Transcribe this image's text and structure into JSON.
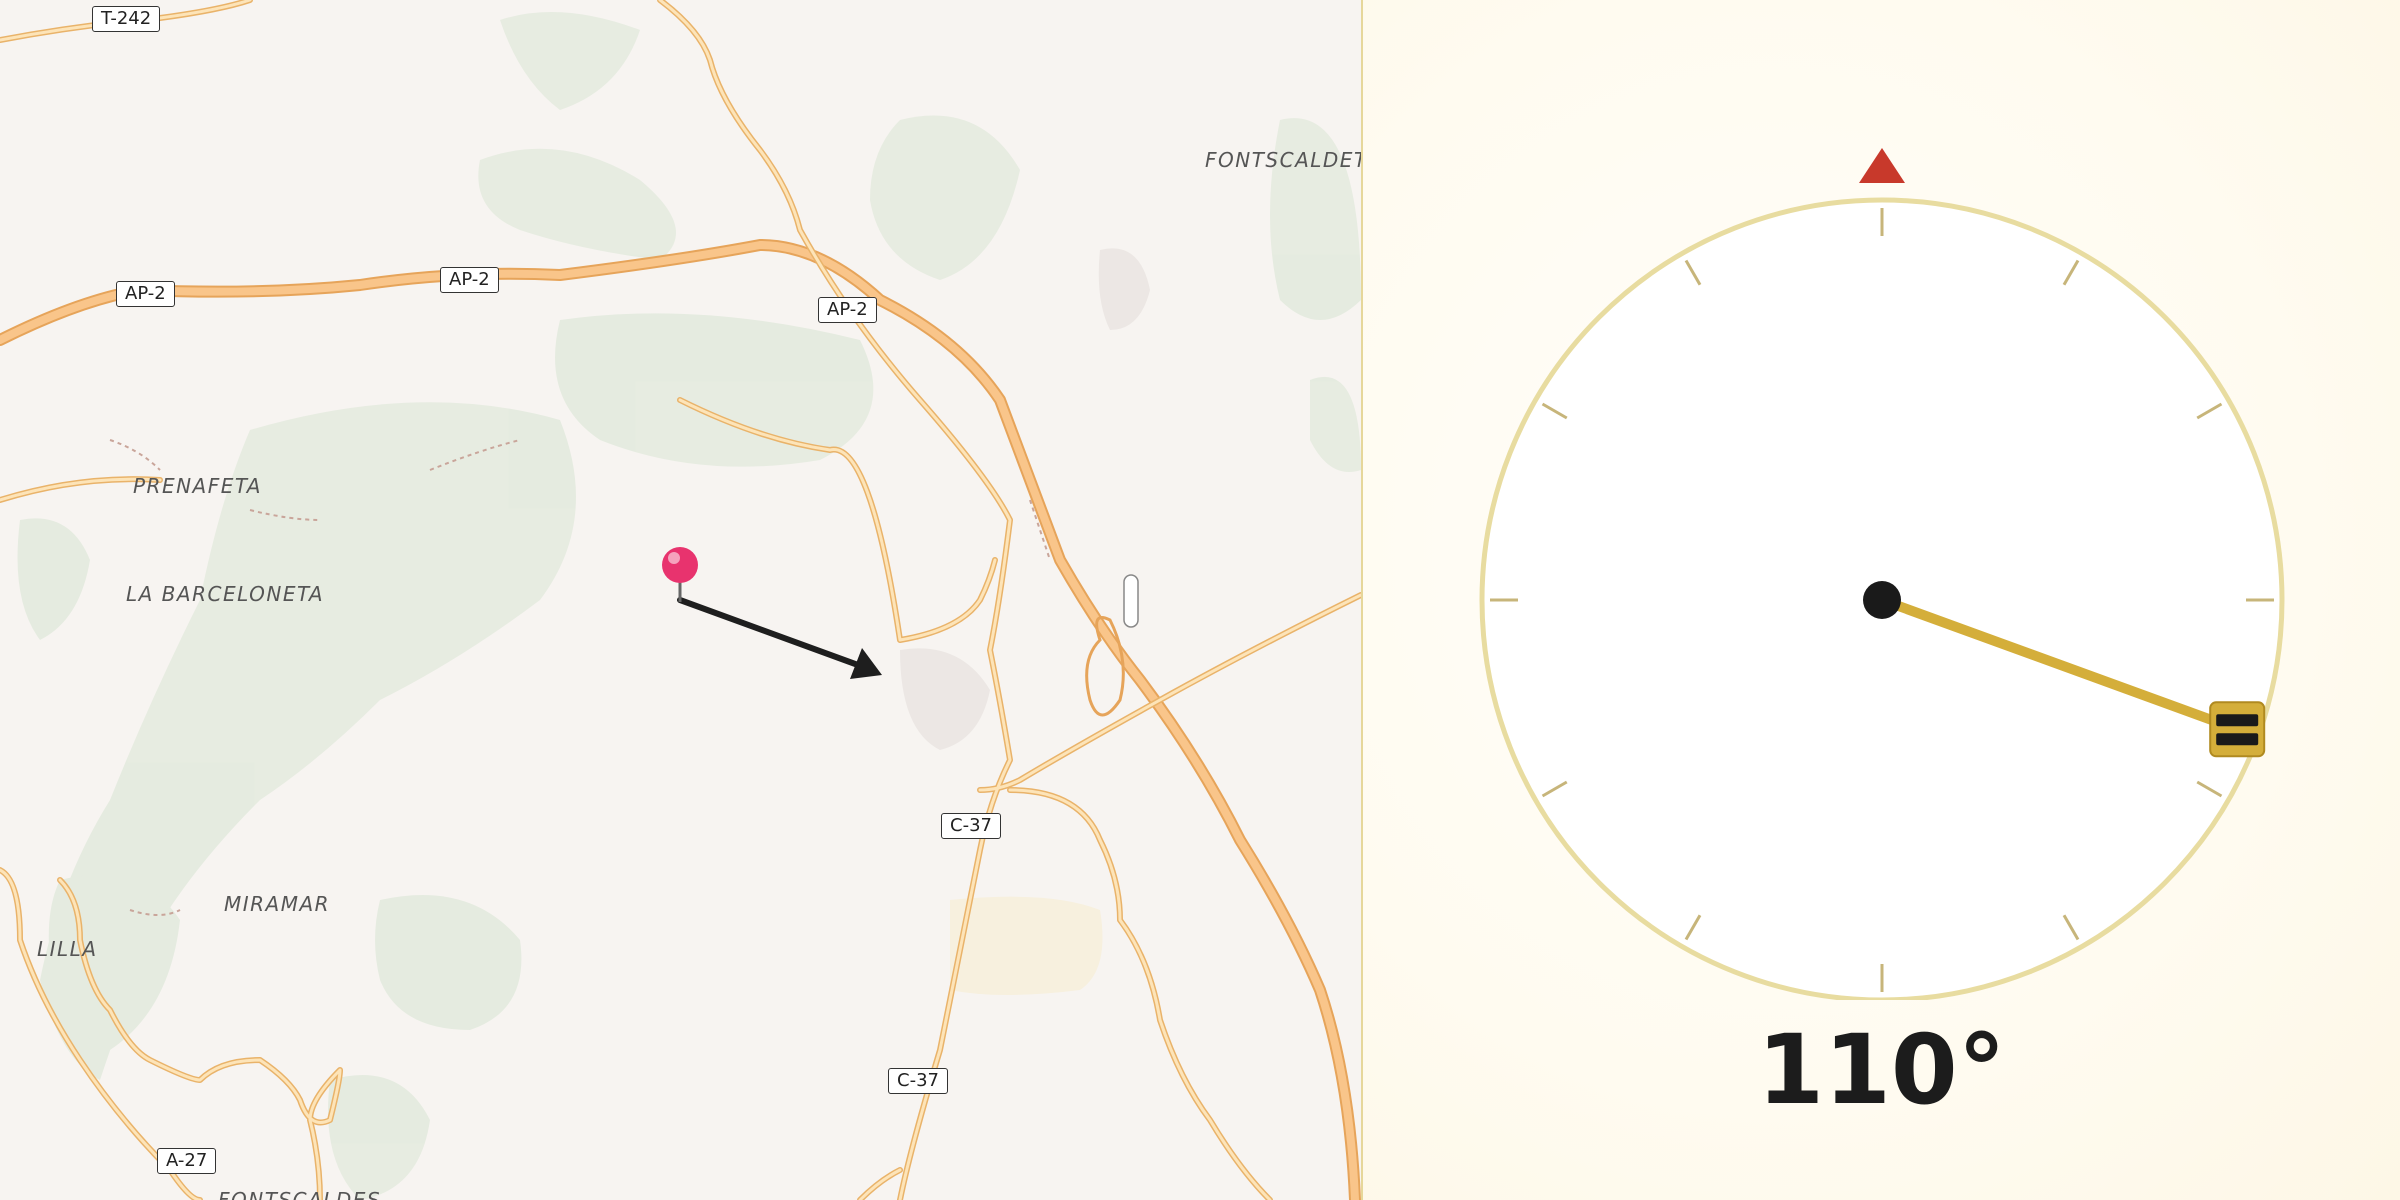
{
  "map": {
    "place_labels": [
      {
        "id": "fontscaldetes",
        "text": "FONTSCALDETE"
      },
      {
        "id": "prenafeta",
        "text": "PRENAFETA"
      },
      {
        "id": "la-barceloneta",
        "text": "LA BARCELONETA"
      },
      {
        "id": "miramar",
        "text": "MIRAMAR"
      },
      {
        "id": "lilla",
        "text": "LILLA"
      },
      {
        "id": "fontscaldes",
        "text": "FONTSCALDES"
      }
    ],
    "road_shields": [
      {
        "id": "t242",
        "text": "T-242"
      },
      {
        "id": "ap2-west",
        "text": "AP-2"
      },
      {
        "id": "ap2-mid",
        "text": "AP-2"
      },
      {
        "id": "ap2-east",
        "text": "AP-2"
      },
      {
        "id": "c37-north",
        "text": "C-37"
      },
      {
        "id": "c37-south",
        "text": "C-37"
      },
      {
        "id": "a27",
        "text": "A-27"
      }
    ],
    "pin_color": "#e8336e",
    "arrow_color": "#1e1e1e"
  },
  "compass": {
    "heading_deg": 110,
    "heading_text": "110°",
    "north_marker_color": "#c8392b",
    "needle_color": "#d4ae3a",
    "ring_color": "#e8dca0"
  }
}
